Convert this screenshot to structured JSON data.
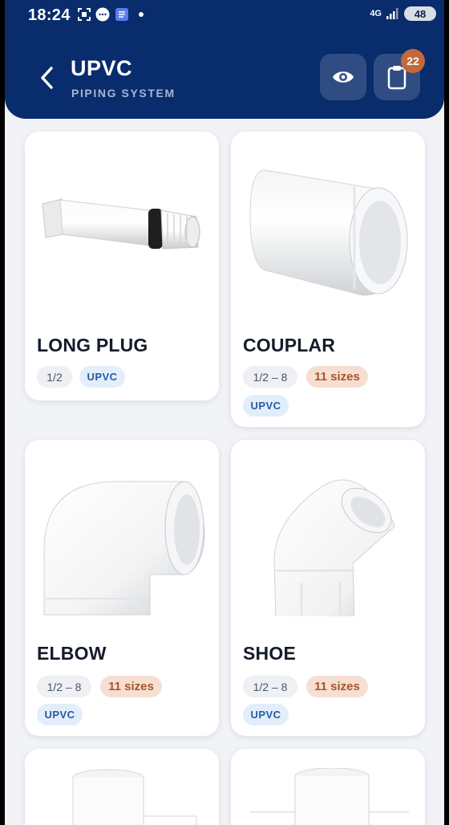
{
  "status": {
    "time": "18:24",
    "network": "4G",
    "battery": "48"
  },
  "header": {
    "title": "UPVC",
    "subtitle": "PIPING SYSTEM",
    "cart_count": "22"
  },
  "products": [
    {
      "name": "LONG PLUG",
      "size_range": "1/2",
      "material": "UPVC"
    },
    {
      "name": "COUPLAR",
      "size_range": "1/2 – 8",
      "sizes_count": "11 sizes",
      "material": "UPVC"
    },
    {
      "name": "ELBOW",
      "size_range": "1/2 – 8",
      "sizes_count": "11 sizes",
      "material": "UPVC"
    },
    {
      "name": "SHOE",
      "size_range": "1/2 – 8",
      "sizes_count": "11 sizes",
      "material": "UPVC"
    }
  ],
  "colors": {
    "header": "#082c6c",
    "badge": "#c2693b",
    "background": "#f1f3f7"
  },
  "icons": [
    "back-icon",
    "eye-icon",
    "clipboard-icon",
    "status-icons"
  ]
}
